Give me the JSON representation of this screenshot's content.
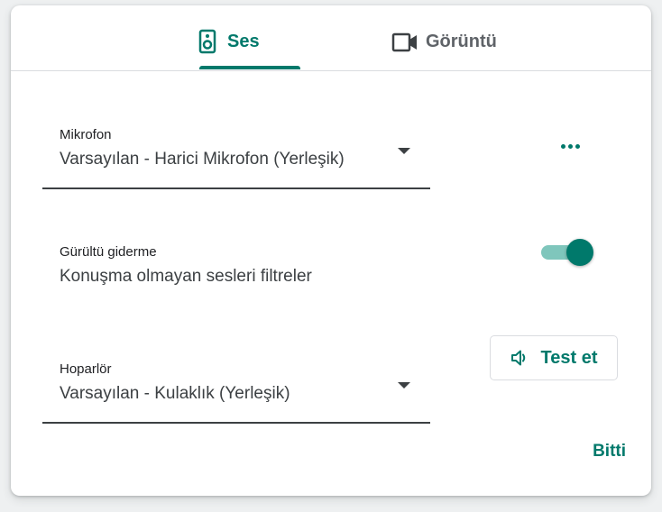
{
  "tabs": [
    {
      "label": "Ses",
      "icon": "speaker-icon",
      "active": true
    },
    {
      "label": "Görüntü",
      "icon": "video-camera-icon",
      "active": false
    }
  ],
  "microphone": {
    "label": "Mikrofon",
    "value": "Varsayılan - Harici Mikrofon (Yerleşik)"
  },
  "noise_cancellation": {
    "label": "Gürültü giderme",
    "description": "Konuşma olmayan sesleri filtreler",
    "enabled": true
  },
  "speaker": {
    "label": "Hoparlör",
    "value": "Varsayılan - Kulaklık (Yerleşik)"
  },
  "buttons": {
    "test": "Test et",
    "done": "Bitti"
  },
  "colors": {
    "accent": "#00796b",
    "track": "#7fc6bc",
    "text_primary": "#202124",
    "text_secondary": "#3c4043",
    "inactive_tab": "#5f6368",
    "divider": "#dadce0"
  }
}
